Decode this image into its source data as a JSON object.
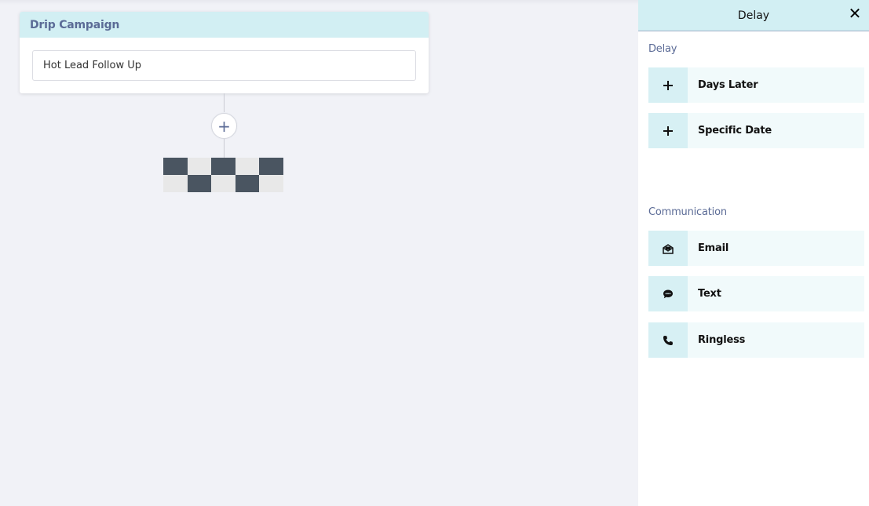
{
  "canvas": {
    "campaign_card": {
      "title": "Drip Campaign",
      "name_value": "Hot Lead Follow Up"
    },
    "add_step_symbol": "+"
  },
  "side_panel": {
    "title": "Delay",
    "close_symbol": "✕",
    "sections": {
      "delay": {
        "title": "Delay",
        "items": [
          {
            "label": "Days Later",
            "icon": "plus-icon"
          },
          {
            "label": "Specific Date",
            "icon": "plus-icon"
          }
        ]
      },
      "communication": {
        "title": "Communication",
        "items": [
          {
            "label": "Email",
            "icon": "envelope-icon"
          },
          {
            "label": "Text",
            "icon": "chat-bubble-icon"
          },
          {
            "label": "Ringless",
            "icon": "phone-icon"
          }
        ]
      }
    }
  },
  "colors": {
    "header_bg": "#d2eff3",
    "accent_text": "#5b6b96",
    "canvas_bg": "#f1f2f7"
  }
}
